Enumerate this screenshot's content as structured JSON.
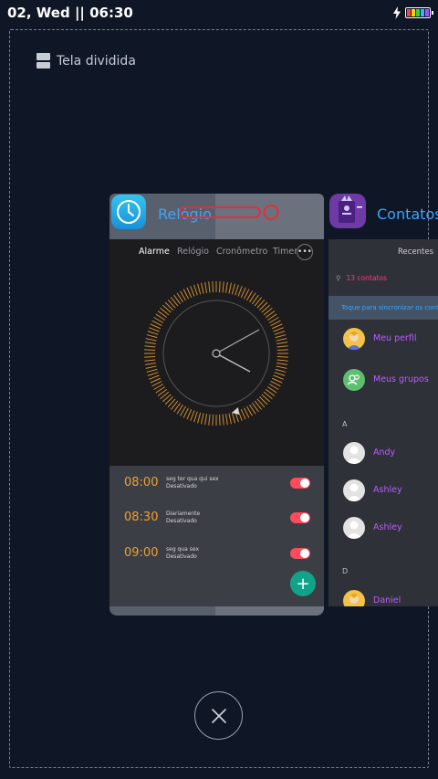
{
  "status_bar": {
    "time": "02, Wed || 06:30",
    "icons": [
      "charging-bolt-icon",
      "battery-icon"
    ],
    "battery_segment_colors": [
      "#ff4040",
      "#ffd400",
      "#35d04a",
      "#2fb6ff",
      "#b04cff"
    ]
  },
  "split_screen": {
    "label": "Tela dividida",
    "icon": "split-screen-icon"
  },
  "clock_app": {
    "title": "Relógio",
    "icon": "clock-icon",
    "tabs": [
      "Alarme",
      "Relógio",
      "Cronômetro",
      "Timer"
    ],
    "more_icon": "more-dots-icon",
    "more_label": "•••",
    "accent": "#f0a030",
    "alarms": [
      {
        "time": "08:00",
        "days": "seg ter qua qui sex",
        "status": "Desativado"
      },
      {
        "time": "08:30",
        "days": "Diariamente",
        "status": "Desativado"
      },
      {
        "time": "09:00",
        "days": "seg qua sex",
        "status": "Desativado"
      }
    ],
    "add_icon": "plus-icon",
    "add_label": "+"
  },
  "contacts_app": {
    "title": "Contatos",
    "icon": "contacts-icon",
    "tab_recent": "Recentes",
    "search_count": "13 contatos",
    "hint": "Toque para sincronizar os contatos",
    "items": [
      {
        "label": "Meu perfil"
      },
      {
        "label": "Meus grupos"
      }
    ],
    "section_a": "A",
    "contacts_a": [
      {
        "name": "Andy"
      },
      {
        "name": "Ashley"
      },
      {
        "name": "Ashley"
      }
    ],
    "section_d": "D",
    "contacts_d": [
      {
        "name": "Daniel"
      }
    ]
  },
  "close_icon": "close-icon"
}
